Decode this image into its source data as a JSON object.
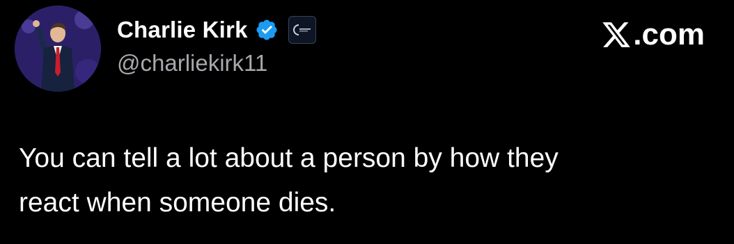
{
  "tweet": {
    "display_name": "Charlie Kirk",
    "handle": "@charliekirk11",
    "text": "You can tell a lot about a person by how they\nreact when someone dies.",
    "verified_color": "#1d9bf0"
  },
  "watermark": {
    "label": ".com",
    "icon": "x-logo-icon"
  },
  "icons": {
    "verified": "verified-badge-icon",
    "affiliate": "affiliate-badge-icon"
  },
  "colors": {
    "background": "#000000",
    "text": "#ffffff",
    "handle": "#a7a9ad"
  }
}
